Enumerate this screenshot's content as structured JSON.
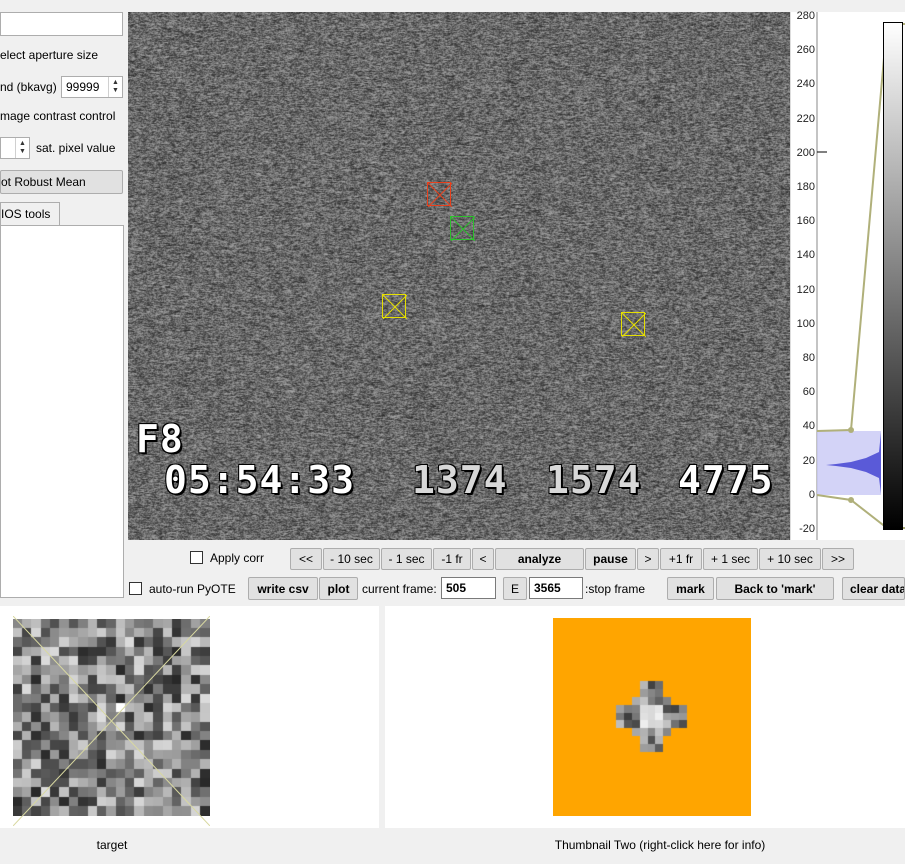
{
  "left_panel": {
    "top_input_value": "",
    "aperture_label": "elect aperture size",
    "bkavg_label": "nd (bkavg)",
    "bkavg_value": "99999",
    "contrast_label": "mage contrast control",
    "sat_pixel_label": "sat. pixel value",
    "robust_mean_button": "ot Robust Mean",
    "tab_label": "IOS tools"
  },
  "main_image": {
    "osd_line1": "F8",
    "osd_time": "05:54:33",
    "osd_num1": "1374",
    "osd_num2": "1574",
    "osd_num3": "4775"
  },
  "histogram": {
    "ticks": [
      "280",
      "260",
      "240",
      "220",
      "200",
      "180",
      "160",
      "140",
      "120",
      "100",
      "80",
      "60",
      "40",
      "20",
      "0",
      "-20"
    ]
  },
  "controls_row1": {
    "apply_corr_label": "Apply corr",
    "btn_first": "<<",
    "btn_minus10": "- 10 sec",
    "btn_minus1sec": "- 1 sec",
    "btn_minus1fr": "-1 fr",
    "btn_prev": "<",
    "btn_analyze": "analyze",
    "btn_pause": "pause",
    "btn_next": ">",
    "btn_plus1fr": "+1 fr",
    "btn_plus1sec": "+ 1 sec",
    "btn_plus10": "+ 10 sec",
    "btn_last": ">>"
  },
  "controls_row2": {
    "autorun_label": "auto-run PyOTE",
    "btn_write_csv": "write csv",
    "btn_plot": "plot",
    "current_frame_label": "current frame:",
    "current_frame_value": "505",
    "btn_e": "E",
    "stop_frame_value": "3565",
    "stop_frame_label": ":stop frame",
    "btn_mark": "mark",
    "btn_back_to_mark": "Back to 'mark'",
    "btn_clear_data": "clear data"
  },
  "thumbnails": {
    "caption_one": "target",
    "caption_two": "Thumbnail Two (right-click here for info)"
  },
  "colors": {
    "thumb_two_bg": "#ffa500",
    "aperture_red": "#e8401c",
    "aperture_green": "#2ec02e",
    "aperture_yellow": "#e6e000",
    "hist_fill": "#5a5ad8"
  }
}
